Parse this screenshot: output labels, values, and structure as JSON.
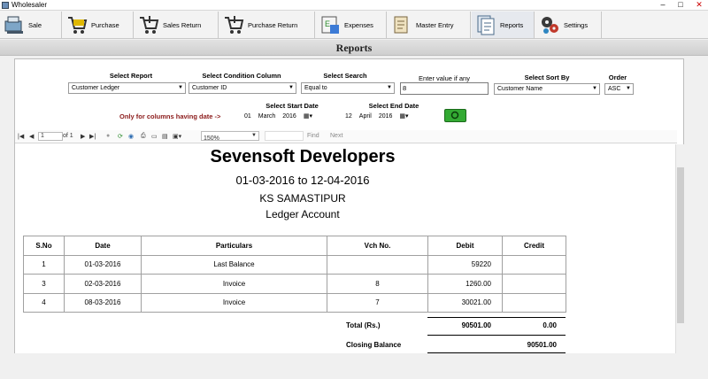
{
  "window": {
    "title": "Wholesaler"
  },
  "toolbar": {
    "items": [
      {
        "label": "Sale"
      },
      {
        "label": "Purchase"
      },
      {
        "label": "Sales Return"
      },
      {
        "label": "Purchase Return"
      },
      {
        "label": "Expenses"
      },
      {
        "label": "Master Entry"
      },
      {
        "label": "Reports"
      },
      {
        "label": "Settings"
      }
    ]
  },
  "header": {
    "title": "Reports"
  },
  "filters": {
    "select_report": {
      "label": "Select Report",
      "value": "Customer Ledger"
    },
    "condition_column": {
      "label": "Select Condition Column",
      "value": "Customer ID"
    },
    "select_search": {
      "label": "Select Search",
      "value": "Equal to"
    },
    "enter_value": {
      "label": "Enter value if any",
      "value": "8"
    },
    "sort_by": {
      "label": "Select Sort By",
      "value": "Customer Name"
    },
    "order": {
      "label": "Order",
      "value": "ASC"
    },
    "date_note": "Only for columns having date ->",
    "start_date": {
      "label": "Select Start Date",
      "day": "01",
      "month": "March",
      "year": "2016"
    },
    "end_date": {
      "label": "Select End Date",
      "day": "12",
      "month": "April",
      "year": "2016"
    }
  },
  "viewer": {
    "page": "1",
    "of": "of 1",
    "zoom": "150%",
    "find": "Find",
    "next": "Next"
  },
  "report": {
    "company": "Sevensoft Developers",
    "period": "01-03-2016 to 12-04-2016",
    "customer": "KS SAMASTIPUR",
    "doc_type": "Ledger Account",
    "columns": [
      "S.No",
      "Date",
      "Particulars",
      "Vch No.",
      "Debit",
      "Credit"
    ],
    "rows": [
      [
        "1",
        "01-03-2016",
        "Last Balance",
        "",
        "59220",
        ""
      ],
      [
        "3",
        "02-03-2016",
        "Invoice",
        "8",
        "1260.00",
        ""
      ],
      [
        "4",
        "08-03-2016",
        "Invoice",
        "7",
        "30021.00",
        ""
      ]
    ],
    "total_label": "Total (Rs.)",
    "total_debit": "90501.00",
    "total_credit": "0.00",
    "closing_label": "Closing Balance",
    "closing_credit": "90501.00"
  }
}
